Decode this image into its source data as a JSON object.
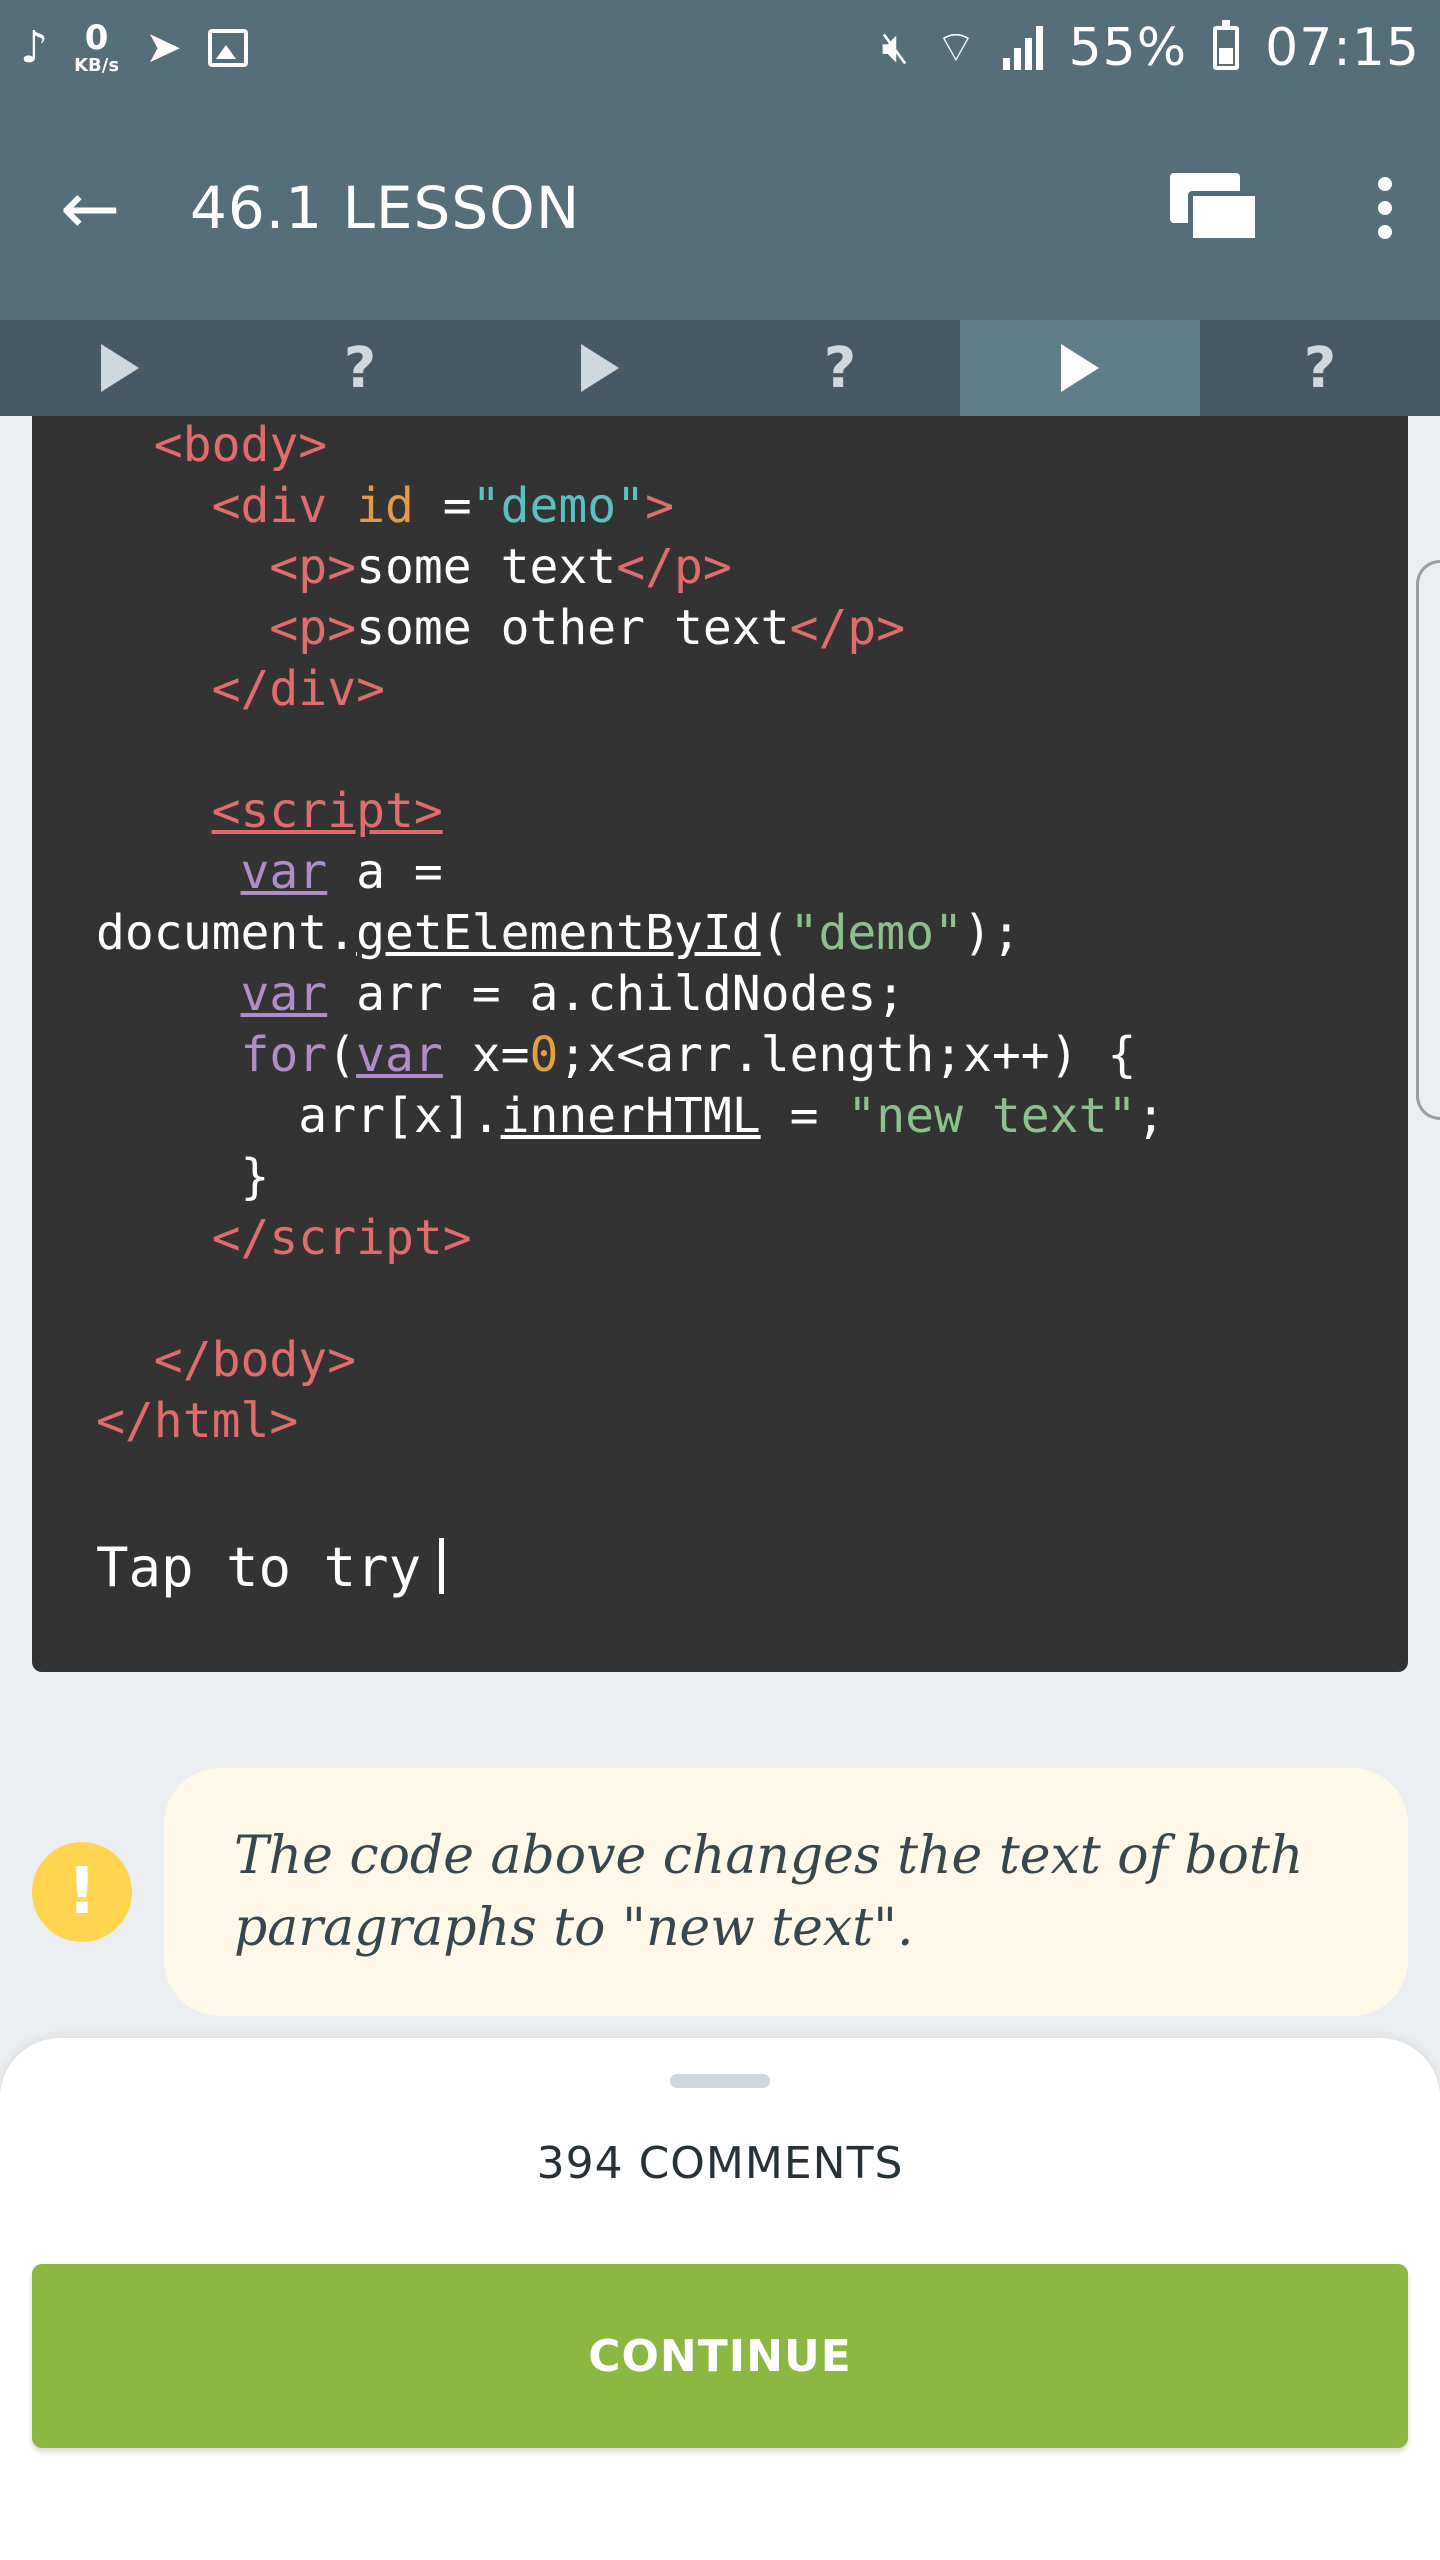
{
  "status_bar": {
    "net_speed_value": "0",
    "net_speed_unit": "KB/s",
    "battery": "55%",
    "time": "07:15"
  },
  "app_bar": {
    "title": "46.1 LESSON"
  },
  "tabs": [
    {
      "type": "play",
      "label": ""
    },
    {
      "type": "quiz",
      "label": "?"
    },
    {
      "type": "play",
      "label": ""
    },
    {
      "type": "quiz",
      "label": "?"
    },
    {
      "type": "play",
      "label": "",
      "active": true
    },
    {
      "type": "quiz",
      "label": "?"
    }
  ],
  "code": {
    "tap_to_try": "Tap to try"
  },
  "note": {
    "icon": "!",
    "text": "The code above changes the text of both paragraphs to \"new text\"."
  },
  "bottom_sheet": {
    "comments": "394 COMMENTS",
    "continue": "CONTINUE"
  },
  "colors": {
    "app_bar": "#546e7a",
    "tab_active": "#607d8b",
    "code_bg": "#333333",
    "note_bg": "#fdf8e7",
    "note_icon": "#ffd54f",
    "continue": "#8bb843"
  }
}
